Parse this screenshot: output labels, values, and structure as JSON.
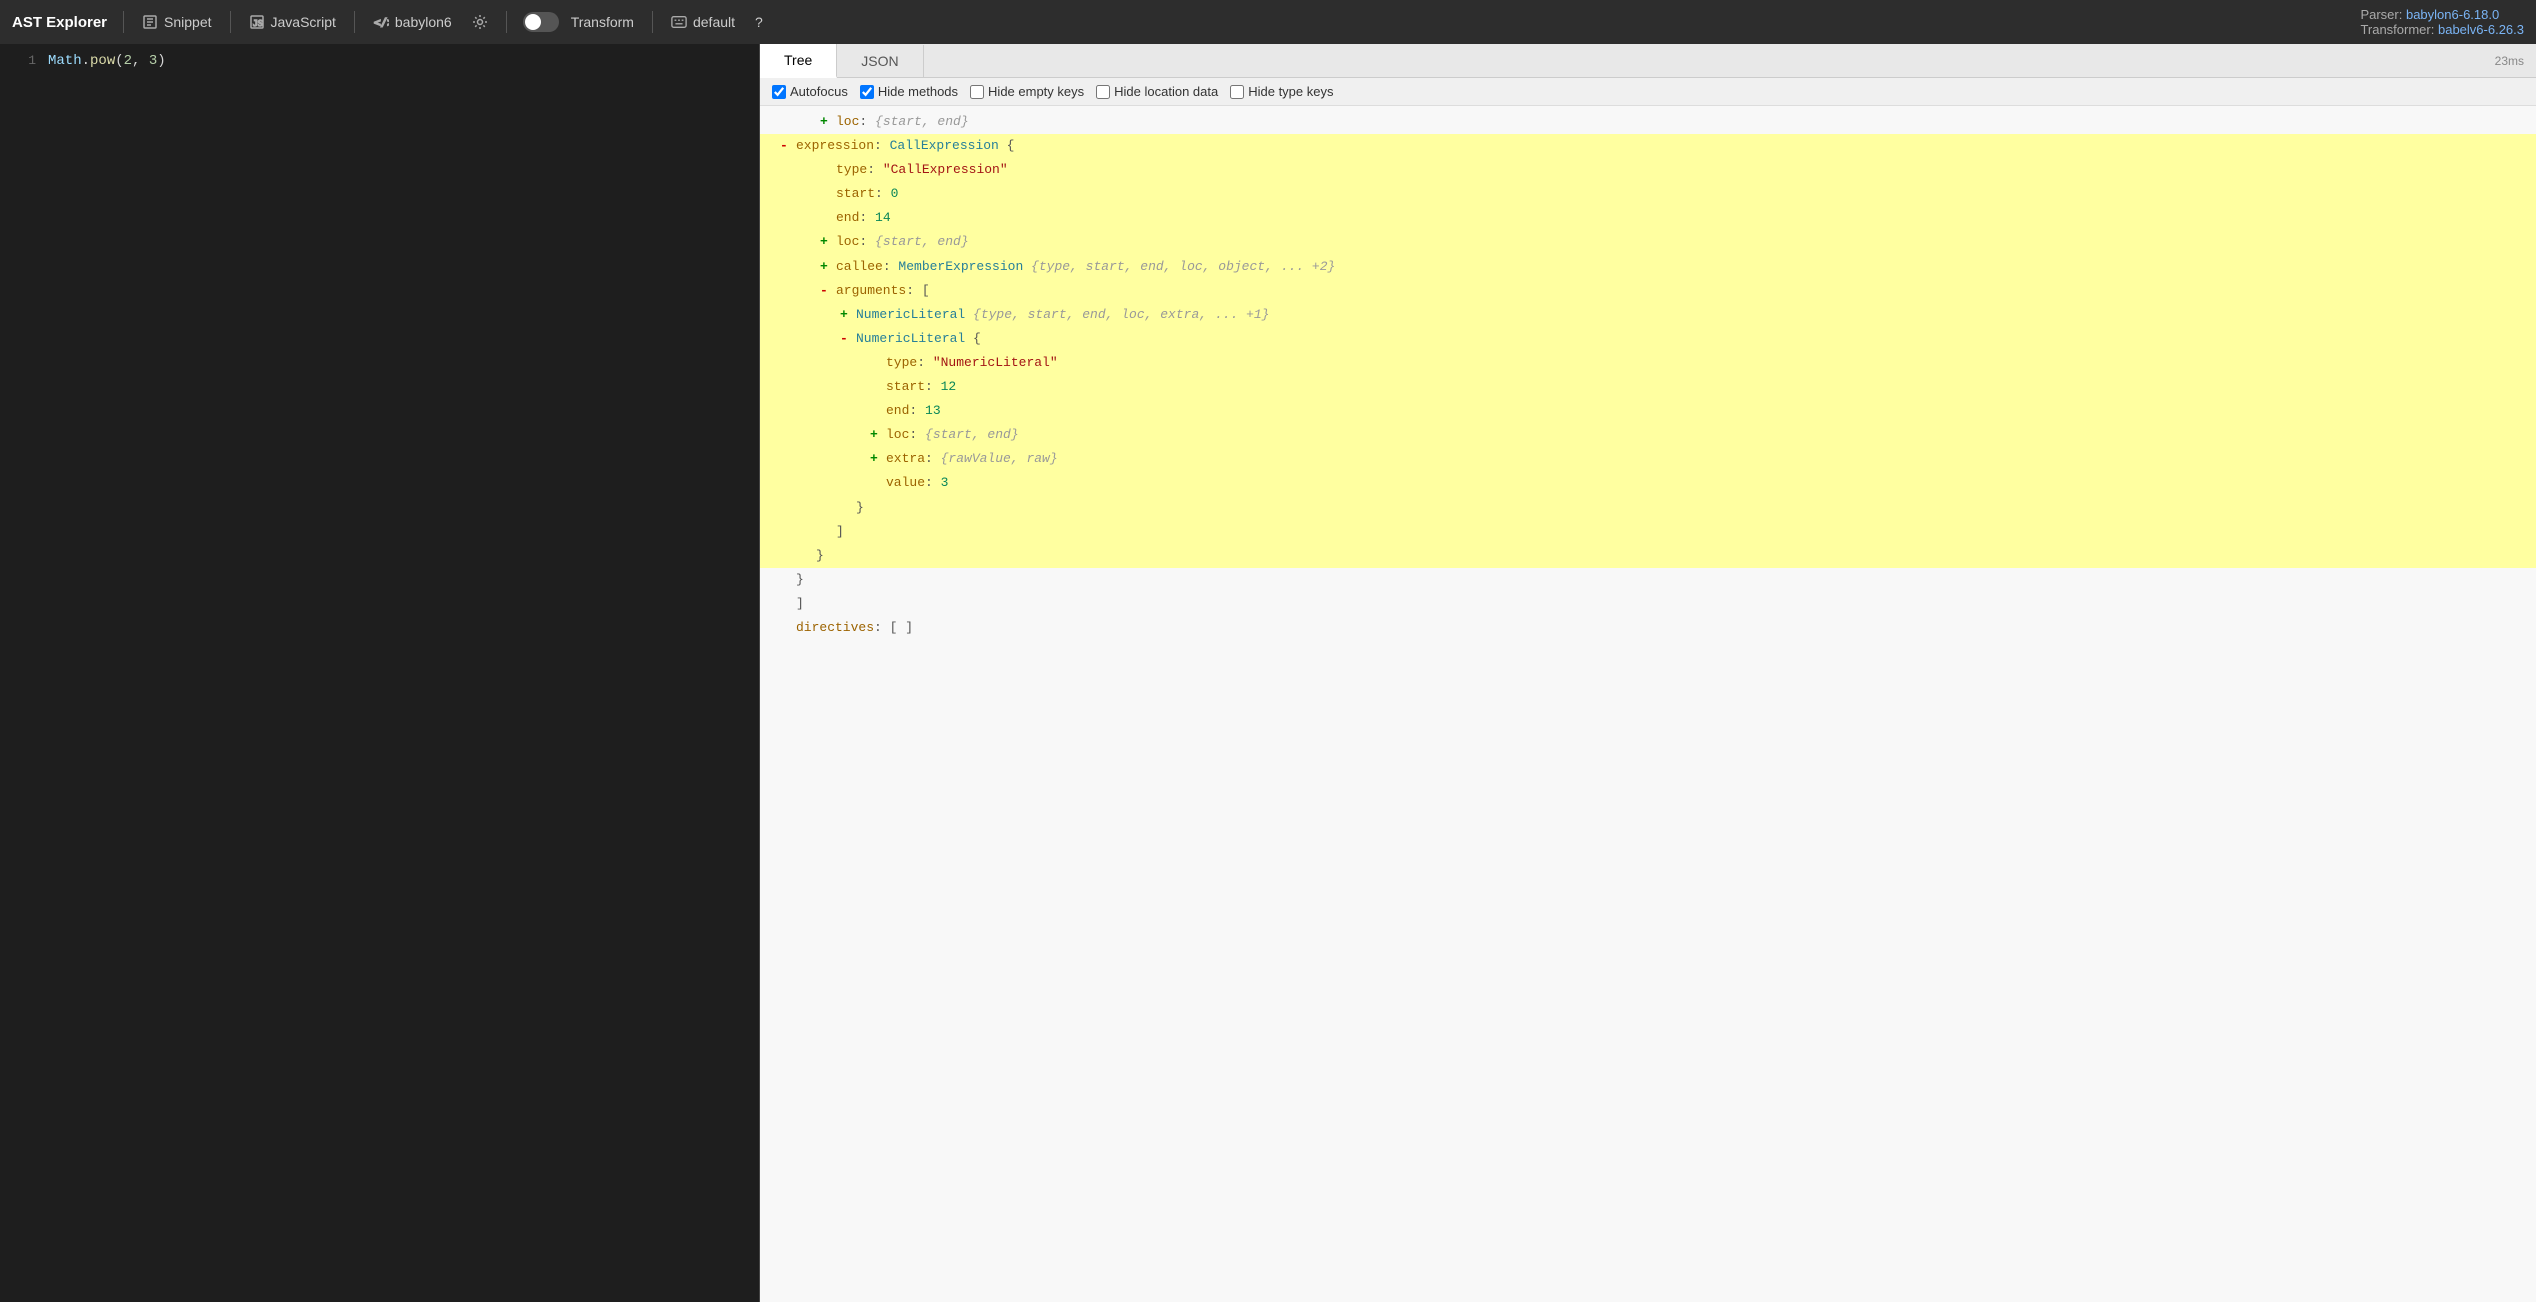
{
  "topbar": {
    "brand": "AST Explorer",
    "snippet_label": "Snippet",
    "js_label": "JavaScript",
    "parser_label": "babylon6",
    "transform_label": "Transform",
    "default_label": "default",
    "help_label": "?",
    "parser_info": "Parser:",
    "parser_version": "babylon6-6.18.0",
    "transformer_info": "Transformer:",
    "transformer_version": "babelv6-6.26.3"
  },
  "editor": {
    "lines": [
      {
        "num": "1",
        "code": "Math.pow(2, 3)"
      }
    ]
  },
  "ast": {
    "tabs": [
      "Tree",
      "JSON"
    ],
    "active_tab": "Tree",
    "timing": "23ms",
    "options": [
      {
        "id": "autofocus",
        "label": "Autofocus",
        "checked": true
      },
      {
        "id": "hide-methods",
        "label": "Hide methods",
        "checked": true
      },
      {
        "id": "hide-empty-keys",
        "label": "Hide empty keys",
        "checked": false
      },
      {
        "id": "hide-location-data",
        "label": "Hide location data",
        "checked": false
      },
      {
        "id": "hide-type-keys",
        "label": "Hide type keys",
        "checked": false
      }
    ],
    "tree_lines": [
      {
        "indent": 40,
        "toggle": "+",
        "toggle_type": "plus",
        "content": "loc: {start, end}",
        "highlighted": false
      },
      {
        "indent": 20,
        "toggle": "-",
        "toggle_type": "minus",
        "content": "expression: CallExpression {",
        "highlighted": true,
        "key": "expression",
        "colon": ": ",
        "type": "CallExpression",
        "after": " {"
      },
      {
        "indent": 60,
        "toggle": null,
        "content": "type: \"CallExpression\"",
        "highlighted": true,
        "key": "type",
        "colon": ": ",
        "strval": "\"CallExpression\""
      },
      {
        "indent": 60,
        "toggle": null,
        "content": "start: 0",
        "highlighted": true,
        "key": "start",
        "colon": ": ",
        "numval": "0"
      },
      {
        "indent": 60,
        "toggle": null,
        "content": "end: 14",
        "highlighted": true,
        "key": "end",
        "colon": ": ",
        "numval": "14"
      },
      {
        "indent": 60,
        "toggle": "+",
        "toggle_type": "plus",
        "content": "loc: {start, end}",
        "highlighted": true
      },
      {
        "indent": 60,
        "toggle": "+",
        "toggle_type": "plus",
        "content": "callee: MemberExpression {type, start, end, loc, object, ... +2}",
        "highlighted": true,
        "key": "callee",
        "colon": ": ",
        "type": "MemberExpression",
        "comment": " {type, start, end, loc, object, ... +2}"
      },
      {
        "indent": 60,
        "toggle": "-",
        "toggle_type": "minus",
        "content": "arguments: [",
        "highlighted": true,
        "key": "arguments",
        "colon": ": ",
        "after": " ["
      },
      {
        "indent": 80,
        "toggle": "+",
        "toggle_type": "plus",
        "content": "NumericLiteral {type, start, end, loc, extra, ... +1}",
        "highlighted": true,
        "type": "NumericLiteral",
        "comment": " {type, start, end, loc, extra, ... +1}"
      },
      {
        "indent": 80,
        "toggle": "-",
        "toggle_type": "minus",
        "content": "NumericLiteral {",
        "highlighted": true,
        "type": "NumericLiteral",
        "after": " {"
      },
      {
        "indent": 100,
        "toggle": null,
        "content": "type: \"NumericLiteral\"",
        "highlighted": true,
        "key": "type",
        "colon": ": ",
        "strval": "\"NumericLiteral\""
      },
      {
        "indent": 100,
        "toggle": null,
        "content": "start: 12",
        "highlighted": true,
        "key": "start",
        "colon": ": ",
        "numval": "12"
      },
      {
        "indent": 100,
        "toggle": null,
        "content": "end: 13",
        "highlighted": true,
        "key": "end",
        "colon": ": ",
        "numval": "13"
      },
      {
        "indent": 100,
        "toggle": "+",
        "toggle_type": "plus",
        "content": "loc: {start, end}",
        "highlighted": true
      },
      {
        "indent": 100,
        "toggle": "+",
        "toggle_type": "plus",
        "content": "extra: {rawValue, raw}",
        "highlighted": true,
        "key": "extra",
        "colon": ": ",
        "comment": "{rawValue, raw}"
      },
      {
        "indent": 100,
        "toggle": null,
        "content": "value: 3",
        "highlighted": true,
        "key": "value",
        "colon": ": ",
        "numval": "3"
      },
      {
        "indent": 80,
        "toggle": null,
        "content": "}",
        "highlighted": true
      },
      {
        "indent": 60,
        "toggle": null,
        "content": "]",
        "highlighted": true
      },
      {
        "indent": 40,
        "toggle": null,
        "content": "}",
        "highlighted": true
      },
      {
        "indent": 20,
        "toggle": null,
        "content": "}",
        "highlighted": false
      },
      {
        "indent": 20,
        "toggle": null,
        "content": "]",
        "highlighted": false
      },
      {
        "indent": 20,
        "toggle": null,
        "content": "directives: [ ]",
        "highlighted": false,
        "key": "directives",
        "colon": ": ",
        "after": "[ ]"
      }
    ]
  }
}
